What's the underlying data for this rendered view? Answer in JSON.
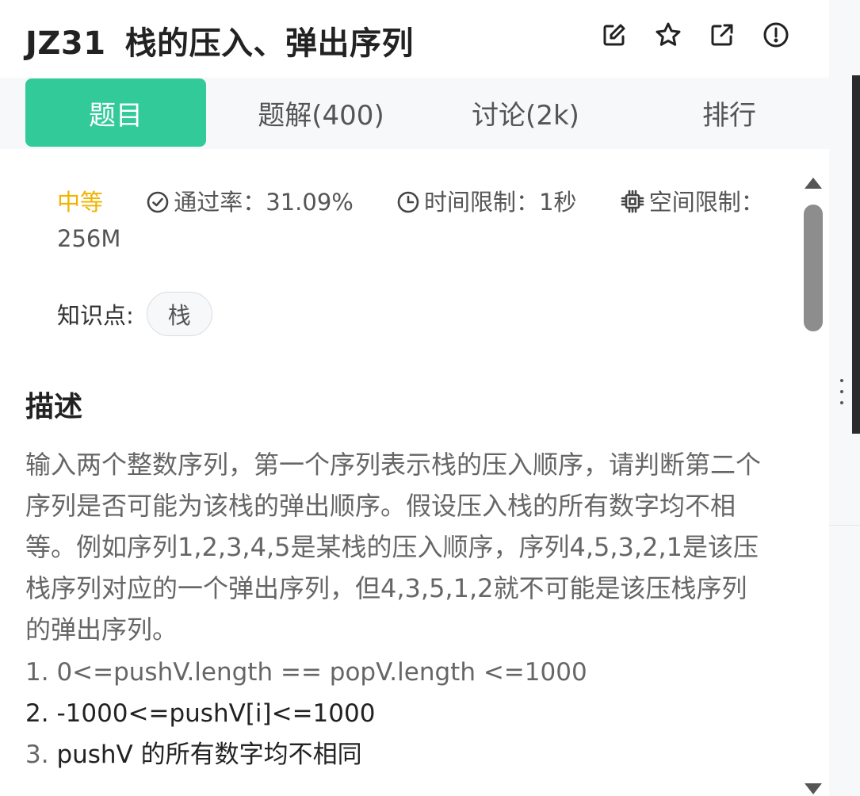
{
  "header": {
    "problem_code": "JZ31",
    "problem_title": "栈的压入、弹出序列",
    "icons": [
      "edit-icon",
      "star-icon",
      "external-link-icon",
      "report-icon"
    ]
  },
  "tabs": [
    {
      "label": "题目",
      "active": true
    },
    {
      "label": "题解(400)",
      "active": false
    },
    {
      "label": "讨论(2k)",
      "active": false
    },
    {
      "label": "排行",
      "active": false
    }
  ],
  "meta": {
    "difficulty": "中等",
    "pass_rate_label": "通过率：",
    "pass_rate_value": "31.09%",
    "time_limit_label": "时间限制：",
    "time_limit_value": "1秒",
    "space_limit_label": "空间限制：",
    "space_limit_value": "256M"
  },
  "knowledge": {
    "label": "知识点:",
    "tags": [
      "栈"
    ]
  },
  "description": {
    "section_title": "描述",
    "paragraph": "输入两个整数序列，第一个序列表示栈的压入顺序，请判断第二个序列是否可能为该栈的弹出顺序。假设压入栈的所有数字均不相等。例如序列1,2,3,4,5是某栈的压入顺序，序列4,5,3,2,1是该压栈序列对应的一个弹出序列，但4,3,5,1,2就不可能是该压栈序列的弹出序列。",
    "items": [
      {
        "num": "1.",
        "text": "0<=pushV.length == popV.length <=1000"
      },
      {
        "num": "2.",
        "text": "-1000<=pushV[i]<=1000"
      },
      {
        "num": "3.",
        "text": "pushV 的所有数字均不相同"
      }
    ]
  },
  "colors": {
    "accent": "#32ca99",
    "difficulty_medium": "#f0b400"
  }
}
